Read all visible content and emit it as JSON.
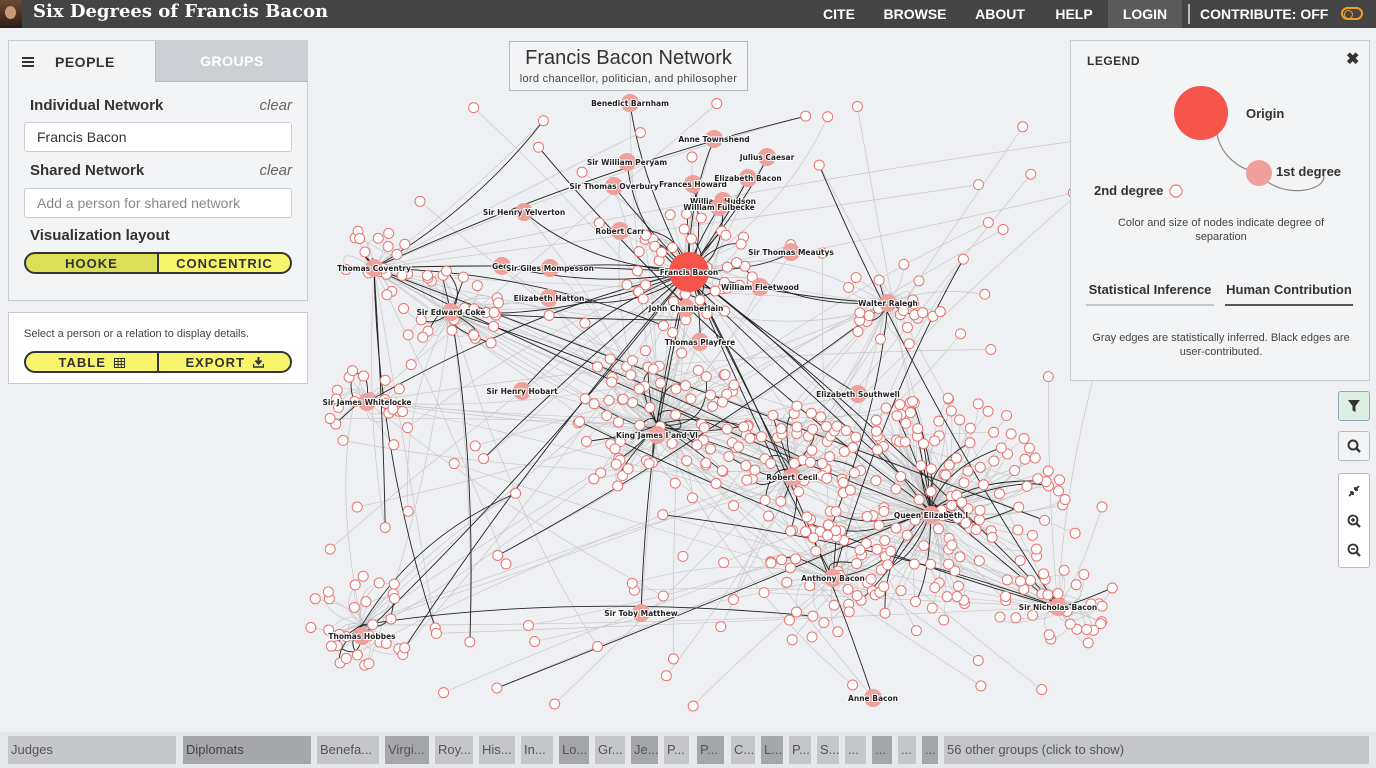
{
  "header": {
    "site_title": "Six Degrees of Francis Bacon",
    "nav": {
      "cite": "CITE",
      "browse": "BROWSE",
      "about": "ABOUT",
      "help": "HELP",
      "login": "LOGIN",
      "contribute": "CONTRIBUTE: OFF"
    }
  },
  "sidebar": {
    "tabs": {
      "people": "PEOPLE",
      "groups": "GROUPS"
    },
    "individual_label": "Individual Network",
    "individual_clear": "clear",
    "individual_value": "Francis Bacon",
    "shared_label": "Shared Network",
    "shared_clear": "clear",
    "shared_placeholder": "Add a person for shared network",
    "layout_label": "Visualization layout",
    "layout_options": {
      "hooke": "HOOKE",
      "concentric": "CONCENTRIC"
    },
    "layout_selected": "HOOKE"
  },
  "details": {
    "hint": "Select a person or a relation to display details.",
    "table_label": "TABLE",
    "export_label": "EXPORT"
  },
  "graph": {
    "title": "Francis Bacon Network",
    "subtitle": "lord chancellor, politician, and philosopher",
    "labeled_nodes": [
      {
        "name": "Benedict Barnham",
        "degree": 1
      },
      {
        "name": "Anne Townshend",
        "degree": 1
      },
      {
        "name": "Sir William Peryam",
        "degree": 1
      },
      {
        "name": "Julius Caesar",
        "degree": 1
      },
      {
        "name": "Sir Thomas Overbury",
        "degree": 1
      },
      {
        "name": "Frances Howard",
        "degree": 1
      },
      {
        "name": "Elizabeth Bacon",
        "degree": 1
      },
      {
        "name": "Sir Henry Yelverton",
        "degree": 1
      },
      {
        "name": "William Hudson",
        "degree": 1
      },
      {
        "name": "William Fulbecke",
        "degree": 1
      },
      {
        "name": "Robert Carr",
        "degree": 1
      },
      {
        "name": "Sir Thomas Meautys",
        "degree": 1
      },
      {
        "name": "Thomas Coventry",
        "degree": 1
      },
      {
        "name": "Geor",
        "degree": 1
      },
      {
        "name": "Sir Giles Mompesson",
        "degree": 1
      },
      {
        "name": "Francis Bacon",
        "degree": 0
      },
      {
        "name": "William Fleetwood",
        "degree": 1
      },
      {
        "name": "Elizabeth Hatton",
        "degree": 1
      },
      {
        "name": "Walter Ralegh",
        "degree": 1
      },
      {
        "name": "Sir Edward Coke",
        "degree": 1
      },
      {
        "name": "John Chamberlain",
        "degree": 1
      },
      {
        "name": "Thomas Playfere",
        "degree": 1
      },
      {
        "name": "Sir Henry Hobart",
        "degree": 1
      },
      {
        "name": "Elizabeth Southwell",
        "degree": 1
      },
      {
        "name": "Sir James Whitelocke",
        "degree": 1
      },
      {
        "name": "King James I and VI",
        "degree": 1
      },
      {
        "name": "Robert Cecil",
        "degree": 1
      },
      {
        "name": "Queen Elizabeth I",
        "degree": 1
      },
      {
        "name": "Anthony Bacon",
        "degree": 1
      },
      {
        "name": "Sir Toby Matthew",
        "degree": 1
      },
      {
        "name": "Sir Nicholas Bacon",
        "degree": 1
      },
      {
        "name": "Thomas Hobbes",
        "degree": 1
      },
      {
        "name": "Anne Bacon",
        "degree": 1
      }
    ],
    "colors": {
      "origin": "#f5544a",
      "first": "#f0a09a",
      "second_fill": "#ffffff",
      "second_stroke": "#e8766e",
      "inferred_edge": "#c8c8c8",
      "user_edge": "#222222"
    }
  },
  "legend": {
    "title": "LEGEND",
    "origin": "Origin",
    "first_degree": "1st degree",
    "second_degree": "2nd degree",
    "description": "Color and size of nodes indicate degree of separation",
    "tab_statistical": "Statistical Inference",
    "tab_human": "Human Contribution",
    "edges_description": "Gray edges are statistically inferred. Black edges are user-contributed."
  },
  "tools": {
    "filter_icon": "filter-icon",
    "search_icon": "search-icon",
    "fit_icon": "compress-icon",
    "zoom_in_icon": "zoom-in-icon",
    "zoom_out_icon": "zoom-out-icon"
  },
  "groups_bar": {
    "chips": [
      "Judges",
      "Diplomats",
      "Benefa...",
      "Virgi...",
      "Roy...",
      "His...",
      "In...",
      "Lo...",
      "Gr...",
      "Je...",
      "P...",
      "P...",
      "C...",
      "L...",
      "P...",
      "S...",
      "...",
      "...",
      "...",
      "..."
    ],
    "more": "56 other groups (click to show)"
  }
}
